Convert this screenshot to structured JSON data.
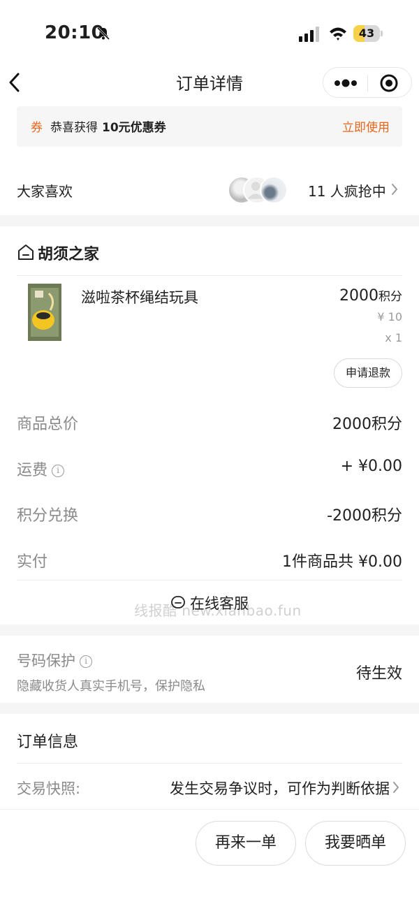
{
  "status_bar": {
    "time": "20:10",
    "battery_level": "43",
    "battery_fraction": 0.43,
    "battery_color": "#f7d14a",
    "icons": [
      "bell-slash-icon",
      "signal-icon",
      "wifi-icon",
      "battery-icon"
    ]
  },
  "nav": {
    "title": "订单详情",
    "icons": [
      "chevron-left-icon",
      "more-dots-icon",
      "target-icon"
    ]
  },
  "coupon": {
    "tag": "券",
    "text": "恭喜获得",
    "highlight": "10元优惠券",
    "action": "立即使用",
    "accent_color": "#e8661b"
  },
  "popular": {
    "label": "大家喜欢",
    "count_text": "11 人疯抢中"
  },
  "shop": {
    "name": "胡须之家"
  },
  "product": {
    "name": "滋啦茶杯绳结玩具",
    "points": "2000",
    "points_unit": "积分",
    "yuan_price": "¥ 10",
    "quantity": "x 1",
    "refund_button": "申请退款"
  },
  "summary": {
    "rows": [
      {
        "label": "商品总价",
        "value": "2000积分"
      },
      {
        "label": "运费",
        "value": "+ ¥0.00"
      },
      {
        "label": "积分兑换",
        "value": "-2000积分"
      },
      {
        "label": "实付",
        "value": "1件商品共 ¥0.00"
      }
    ]
  },
  "service": {
    "label": "在线客服",
    "watermark": "线报酷 new.xianbao.fun"
  },
  "protection": {
    "title": "号码保护",
    "description": "隐藏收货人真实手机号，保护隐私",
    "status": "待生效"
  },
  "order_info": {
    "title": "订单信息",
    "snapshot_label": "交易快照:",
    "snapshot_value": "发生交易争议时，可作为判断依据"
  },
  "bottom": {
    "reorder_button": "再来一单",
    "review_button": "我要晒单"
  }
}
